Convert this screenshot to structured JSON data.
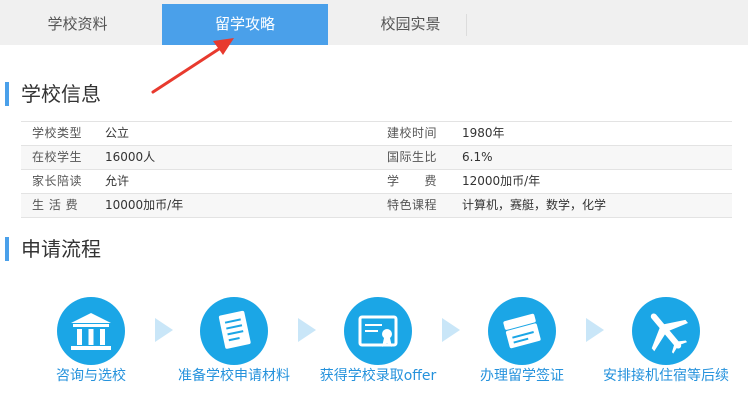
{
  "tabs": [
    {
      "label": "学校资料"
    },
    {
      "label": "留学攻略"
    },
    {
      "label": "校园实景"
    }
  ],
  "sections": {
    "school_info_title": "学校信息",
    "process_title": "申请流程"
  },
  "school_info": [
    {
      "label1": "学校类型",
      "value1": "公立",
      "label2": "建校时间",
      "value2": "1980年"
    },
    {
      "label1": "在校学生",
      "value1": "16000人",
      "label2": "国际生比",
      "value2": "6.1%"
    },
    {
      "label1": "家长陪读",
      "value1": "允许",
      "label2": "学　　费",
      "value2": "12000加币/年"
    },
    {
      "label1": "生 活 费",
      "value1": "10000加币/年",
      "label2": "特色课程",
      "value2": "计算机，赛艇，数学，化学"
    }
  ],
  "process_steps": [
    {
      "label": "咨询与选校",
      "icon": "school-building-icon"
    },
    {
      "label": "准备学校申请材料",
      "icon": "documents-icon"
    },
    {
      "label": "获得学校录取offer",
      "icon": "certificate-icon"
    },
    {
      "label": "办理留学签证",
      "icon": "passport-icon"
    },
    {
      "label": "安排接机住宿等后续",
      "icon": "airplane-icon"
    }
  ],
  "colors": {
    "accent": "#4aa0ea",
    "step_circle": "#1ba6e6",
    "step_label": "#2592dc",
    "pointer_arrow": "#e83a2e"
  }
}
